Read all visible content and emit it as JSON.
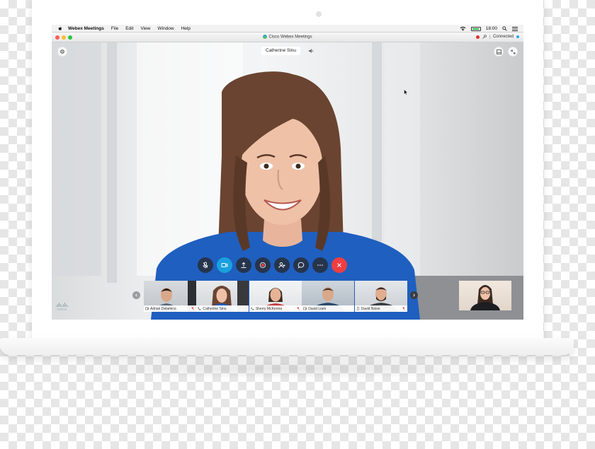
{
  "menubar": {
    "app_name": "Webex Meetings",
    "menus": [
      "File",
      "Edit",
      "View",
      "Window",
      "Help"
    ],
    "time": "18:00"
  },
  "window": {
    "title": "Cisco Webex Meetings",
    "connection_status": "Connected"
  },
  "video": {
    "active_speaker": "Catherine Sinu"
  },
  "controls": [
    {
      "name": "mute-button",
      "icon": "microphone-icon"
    },
    {
      "name": "video-button",
      "icon": "video-camera-icon"
    },
    {
      "name": "share-button",
      "icon": "share-upload-icon"
    },
    {
      "name": "record-button",
      "icon": "record-icon"
    },
    {
      "name": "participants-button",
      "icon": "add-participant-icon"
    },
    {
      "name": "chat-button",
      "icon": "chat-bubble-icon"
    },
    {
      "name": "more-button",
      "icon": "more-dots-icon"
    },
    {
      "name": "end-call-button",
      "icon": "close-x-icon"
    }
  ],
  "participants": [
    {
      "name": "Adrian Delamico",
      "device": "video-device-icon",
      "muted": true
    },
    {
      "name": "Catherine Sinu",
      "device": "phone-icon",
      "muted": false
    },
    {
      "name": "Sherry McKenna",
      "device": "phone-icon",
      "muted": true
    },
    {
      "name": "David Liam",
      "device": "video-device-icon",
      "muted": false
    },
    {
      "name": "David Noise",
      "device": "mobile-icon",
      "muted": true
    }
  ],
  "branding": {
    "logo_text": "cisco"
  },
  "colors": {
    "accent_blue": "#1aa0de",
    "end_call_red": "#ef3e42",
    "battery_green": "#2db54a",
    "shirt_blue": "#1f5fbf"
  },
  "battery_level": 0.85
}
